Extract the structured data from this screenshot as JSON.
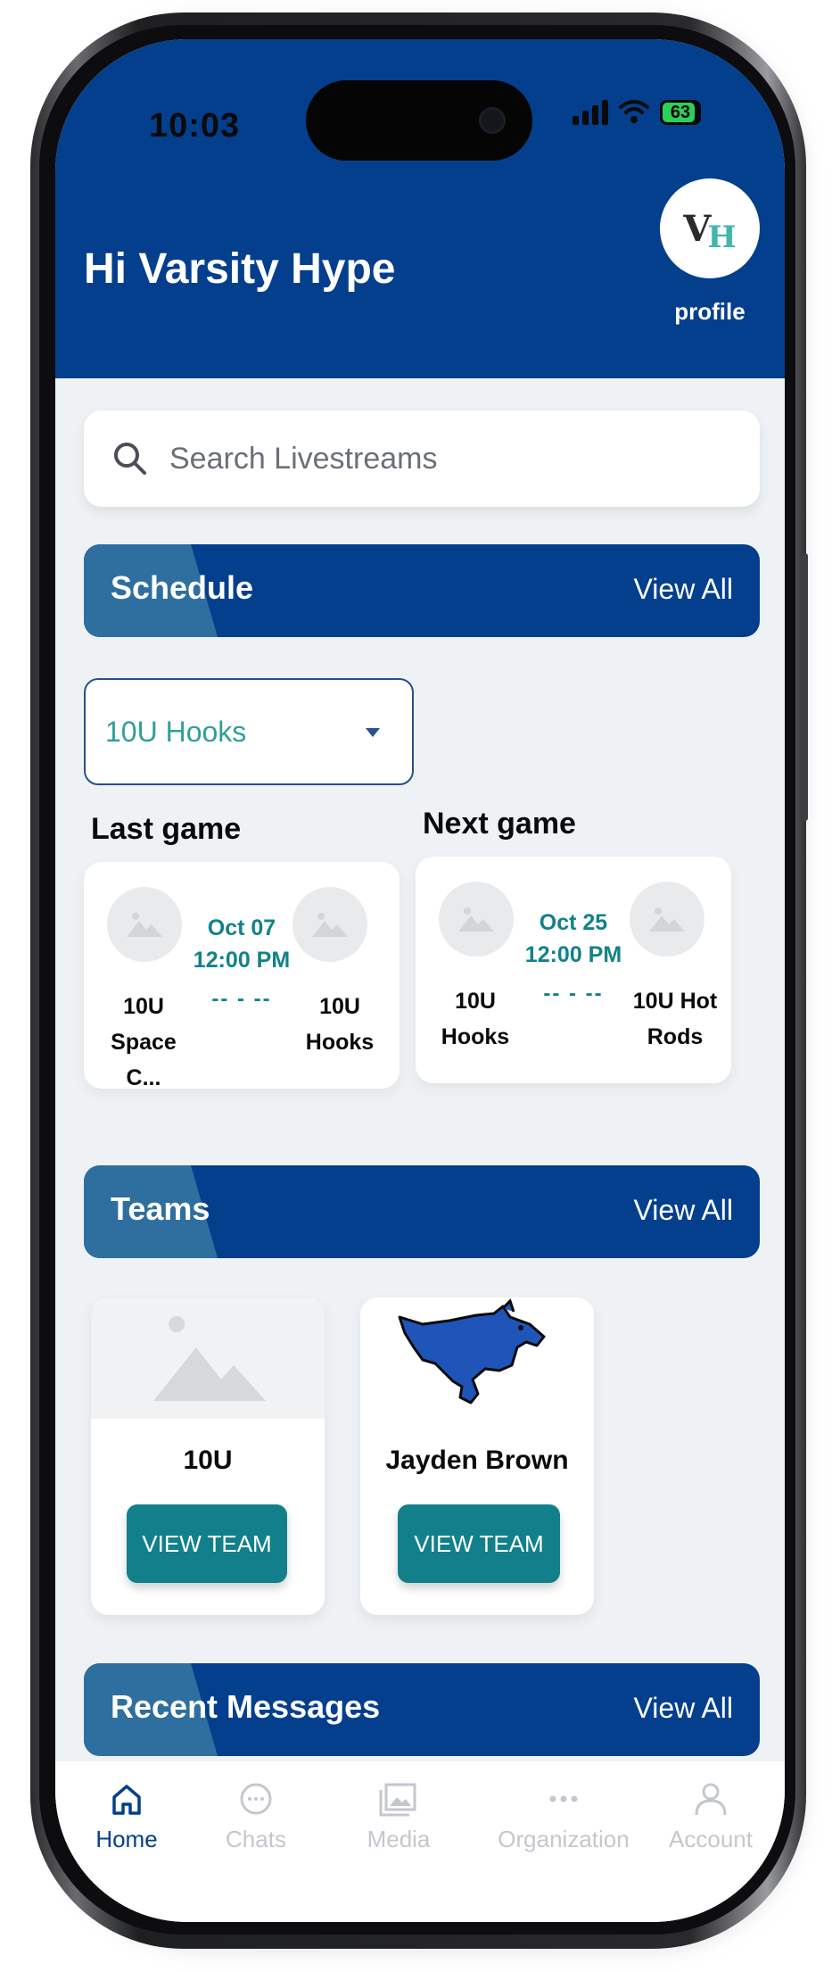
{
  "status_bar": {
    "time": "10:03",
    "battery": "63"
  },
  "header": {
    "greeting": "Hi Varsity Hype",
    "avatar_initials": [
      "V",
      "H"
    ],
    "profile_label": "profile"
  },
  "search": {
    "placeholder": "Search Livestreams"
  },
  "schedule": {
    "title": "Schedule",
    "view_all": "View All",
    "team_select": "10U Hooks",
    "last_game": {
      "heading": "Last game",
      "date": "Oct 07",
      "time": "12:00 PM",
      "score": "-- - --",
      "home_team": "10U Space C...",
      "away_team": "10U Hooks"
    },
    "next_game": {
      "heading": "Next game",
      "date": "Oct 25",
      "time": "12:00 PM",
      "score": "-- - --",
      "home_team": "10U Hooks",
      "away_team": "10U Hot Rods"
    }
  },
  "teams": {
    "title": "Teams",
    "view_all": "View All",
    "items": [
      {
        "name": "10U",
        "button": "VIEW TEAM",
        "image": "placeholder-image-icon"
      },
      {
        "name": "Jayden Brown",
        "button": "VIEW TEAM",
        "image": "mustang-logo-icon"
      }
    ]
  },
  "messages": {
    "title": "Recent Messages",
    "view_all": "View All"
  },
  "tab_bar": {
    "items": [
      {
        "label": "Home",
        "icon": "home-icon",
        "active": true
      },
      {
        "label": "Chats",
        "icon": "chat-icon",
        "active": false
      },
      {
        "label": "Media",
        "icon": "media-icon",
        "active": false
      },
      {
        "label": "Organization",
        "icon": "more-dots-icon",
        "active": false
      },
      {
        "label": "Account",
        "icon": "account-icon",
        "active": false
      }
    ]
  },
  "colors": {
    "brand_blue": "#043f8d",
    "teal": "#11808a",
    "active_tab": "#043f8d",
    "inactive_tab": "#c4c7cd"
  }
}
